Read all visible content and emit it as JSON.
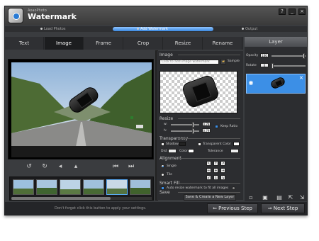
{
  "app": {
    "brand_small": "AoaoPhoto",
    "brand_big": "Watermark"
  },
  "window": {
    "help": "?",
    "minimize": "_",
    "close": "×"
  },
  "steps": [
    {
      "label": "Load Photos"
    },
    {
      "label": "Add Watermark"
    },
    {
      "label": "Output"
    }
  ],
  "tabs": [
    {
      "label": "Text"
    },
    {
      "label": "Image"
    },
    {
      "label": "Frame"
    },
    {
      "label": "Crop"
    },
    {
      "label": "Resize"
    },
    {
      "label": "Rename"
    }
  ],
  "image_panel": {
    "section": "Image",
    "placeholder": "Click to add image watermark",
    "sample_label": "Sample",
    "resize": {
      "section": "Resize",
      "w_label": "w:",
      "h_label": "h:",
      "w_value": "0.79",
      "h_value": "0.79",
      "keep_ratio": "Keep Ratio"
    },
    "transparency": {
      "section": "Transparency",
      "shadow": "Shadow",
      "transparent_color": "Transparent Color",
      "dist": "Dist",
      "color": "Color",
      "tolerance": "Tolerance"
    },
    "alignment": {
      "section": "Alignment",
      "single": "Single",
      "tile": "Tile"
    },
    "smart_fill": {
      "section": "Smart Fill",
      "auto_resize": "Auto resize watermark to fit all images"
    },
    "save": {
      "section": "Save",
      "button": "Save & Create a New Layer"
    }
  },
  "layer": {
    "header": "Layer",
    "opacity_label": "Opacity",
    "opacity_value": "100",
    "rotate_label": "Rotate",
    "rotate_value": "0"
  },
  "footer": {
    "hint": "Don't forget click this button to apply your settings.",
    "prev": "Previous Step",
    "next": "Next Step"
  },
  "colors": {
    "accent": "#3c8fe6"
  }
}
